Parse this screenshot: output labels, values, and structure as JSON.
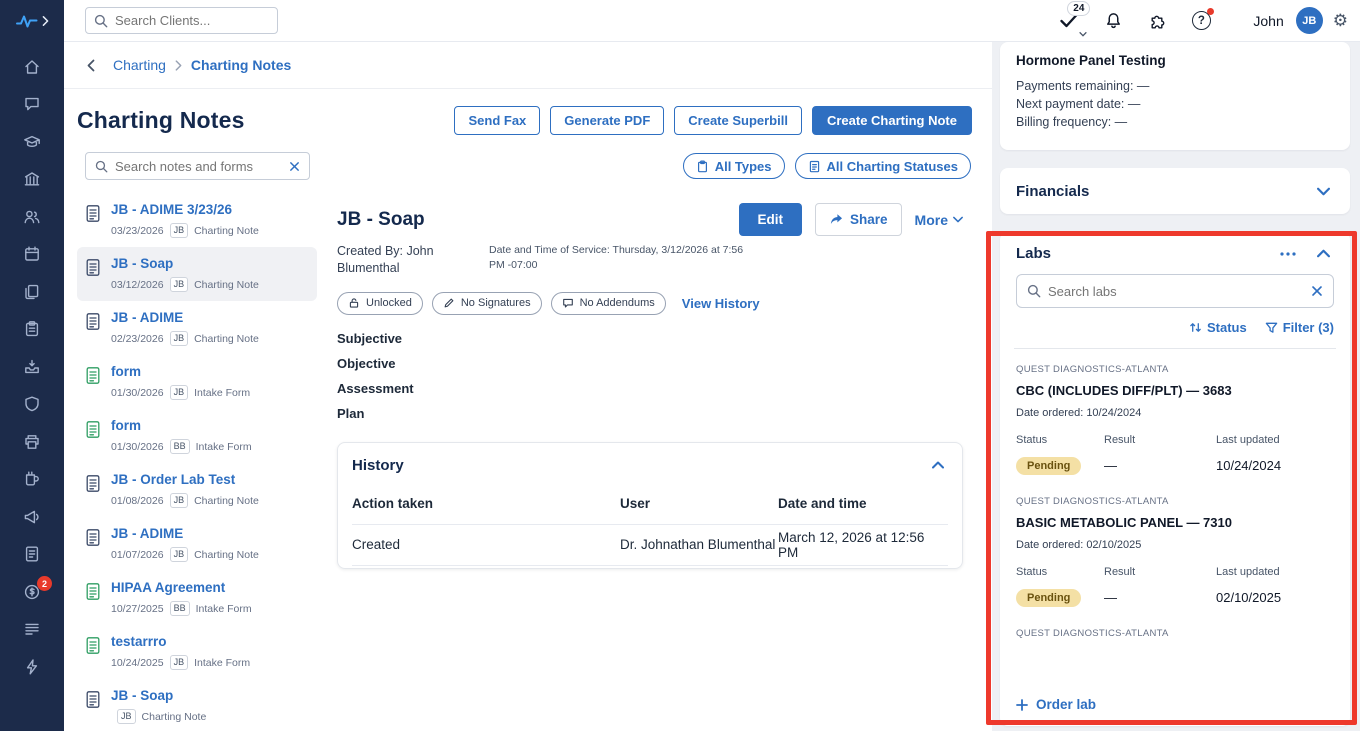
{
  "colors": {
    "accent": "#2e6fc1",
    "sidebar": "#1c2b4a",
    "annotation": "#ee392c",
    "pending_bg": "#f4e0a5",
    "pending_text": "#6a520f",
    "form_green": "#2f9e63"
  },
  "sidebar": {
    "items": [
      "home",
      "messages",
      "education",
      "organization",
      "clients",
      "calendar",
      "documents",
      "forms",
      "inbox",
      "security",
      "fax",
      "packages",
      "marketing",
      "reports",
      "billing",
      "menu",
      "automations"
    ],
    "badge_item": "billing",
    "badge": "2"
  },
  "topbar": {
    "search_placeholder": "Search Clients...",
    "tasks_badge": "24",
    "user_name": "John",
    "avatar_initials": "JB"
  },
  "breadcrumb": {
    "parent": "Charting",
    "current": "Charting Notes"
  },
  "page_header": {
    "title": "Charting Notes",
    "buttons": {
      "send_fax": "Send Fax",
      "generate_pdf": "Generate PDF",
      "create_superbill": "Create Superbill",
      "create_charting_note": "Create Charting Note"
    }
  },
  "notes_toolbar": {
    "search_placeholder": "Search notes and forms",
    "type_filter": "All Types",
    "status_filter": "All Charting Statuses"
  },
  "notes_list": [
    {
      "title": "JB - ADIME 3/23/26",
      "date": "03/23/2026",
      "initials": "JB",
      "type": "Charting Note",
      "kind": "note",
      "selected": false
    },
    {
      "title": "JB - Soap",
      "date": "03/12/2026",
      "initials": "JB",
      "type": "Charting Note",
      "kind": "note",
      "selected": true
    },
    {
      "title": "JB - ADIME",
      "date": "02/23/2026",
      "initials": "JB",
      "type": "Charting Note",
      "kind": "note",
      "selected": false
    },
    {
      "title": "form",
      "date": "01/30/2026",
      "initials": "JB",
      "type": "Intake Form",
      "kind": "form",
      "selected": false
    },
    {
      "title": "form",
      "date": "01/30/2026",
      "initials": "BB",
      "type": "Intake Form",
      "kind": "form",
      "selected": false
    },
    {
      "title": "JB - Order Lab Test",
      "date": "01/08/2026",
      "initials": "JB",
      "type": "Charting Note",
      "kind": "note",
      "selected": false
    },
    {
      "title": "JB - ADIME",
      "date": "01/07/2026",
      "initials": "JB",
      "type": "Charting Note",
      "kind": "note",
      "selected": false
    },
    {
      "title": "HIPAA Agreement",
      "date": "10/27/2025",
      "initials": "BB",
      "type": "Intake Form",
      "kind": "form",
      "selected": false
    },
    {
      "title": "testarrro",
      "date": "10/24/2025",
      "initials": "JB",
      "type": "Intake Form",
      "kind": "form",
      "selected": false
    },
    {
      "title": "JB - Soap",
      "date": "",
      "initials": "JB",
      "type": "Charting Note",
      "kind": "note",
      "selected": false
    }
  ],
  "note_detail": {
    "title": "JB - Soap",
    "edit_label": "Edit",
    "share_label": "Share",
    "more_label": "More",
    "created_by": "Created By: John Blumenthal",
    "service_datetime": "Date and Time of Service: Thursday, 3/12/2026 at 7:56 PM -07:00",
    "status_pills": [
      "Unlocked",
      "No Signatures",
      "No Addendums"
    ],
    "view_history": "View History",
    "sections": [
      "Subjective",
      "Objective",
      "Assessment",
      "Plan"
    ],
    "history": {
      "title": "History",
      "columns": [
        "Action taken",
        "User",
        "Date and time"
      ],
      "rows": [
        {
          "action": "Created",
          "user": "Dr. Johnathan Blumenthal",
          "datetime": "March 12, 2026 at 12:56 PM"
        }
      ]
    }
  },
  "right_panel": {
    "package_card": {
      "title": "Hormone Panel Testing",
      "rows": [
        "Payments remaining: —",
        "Next payment date: —",
        "Billing frequency: —"
      ]
    },
    "financials_card": {
      "title": "Financials"
    },
    "labs_card": {
      "title": "Labs",
      "search_placeholder": "Search labs",
      "status_button": "Status",
      "filter_button": "Filter (3)",
      "columns": [
        "Status",
        "Result",
        "Last updated"
      ],
      "entries": [
        {
          "vendor": "QUEST DIAGNOSTICS-ATLANTA",
          "name": "CBC (INCLUDES DIFF/PLT) — 3683",
          "ordered": "Date ordered: 10/24/2024",
          "status": "Pending",
          "result": "—",
          "updated": "10/24/2024"
        },
        {
          "vendor": "QUEST DIAGNOSTICS-ATLANTA",
          "name": "BASIC METABOLIC PANEL — 7310",
          "ordered": "Date ordered: 02/10/2025",
          "status": "Pending",
          "result": "—",
          "updated": "02/10/2025"
        },
        {
          "vendor": "QUEST DIAGNOSTICS-ATLANTA"
        }
      ],
      "order_lab": "Order lab"
    }
  }
}
